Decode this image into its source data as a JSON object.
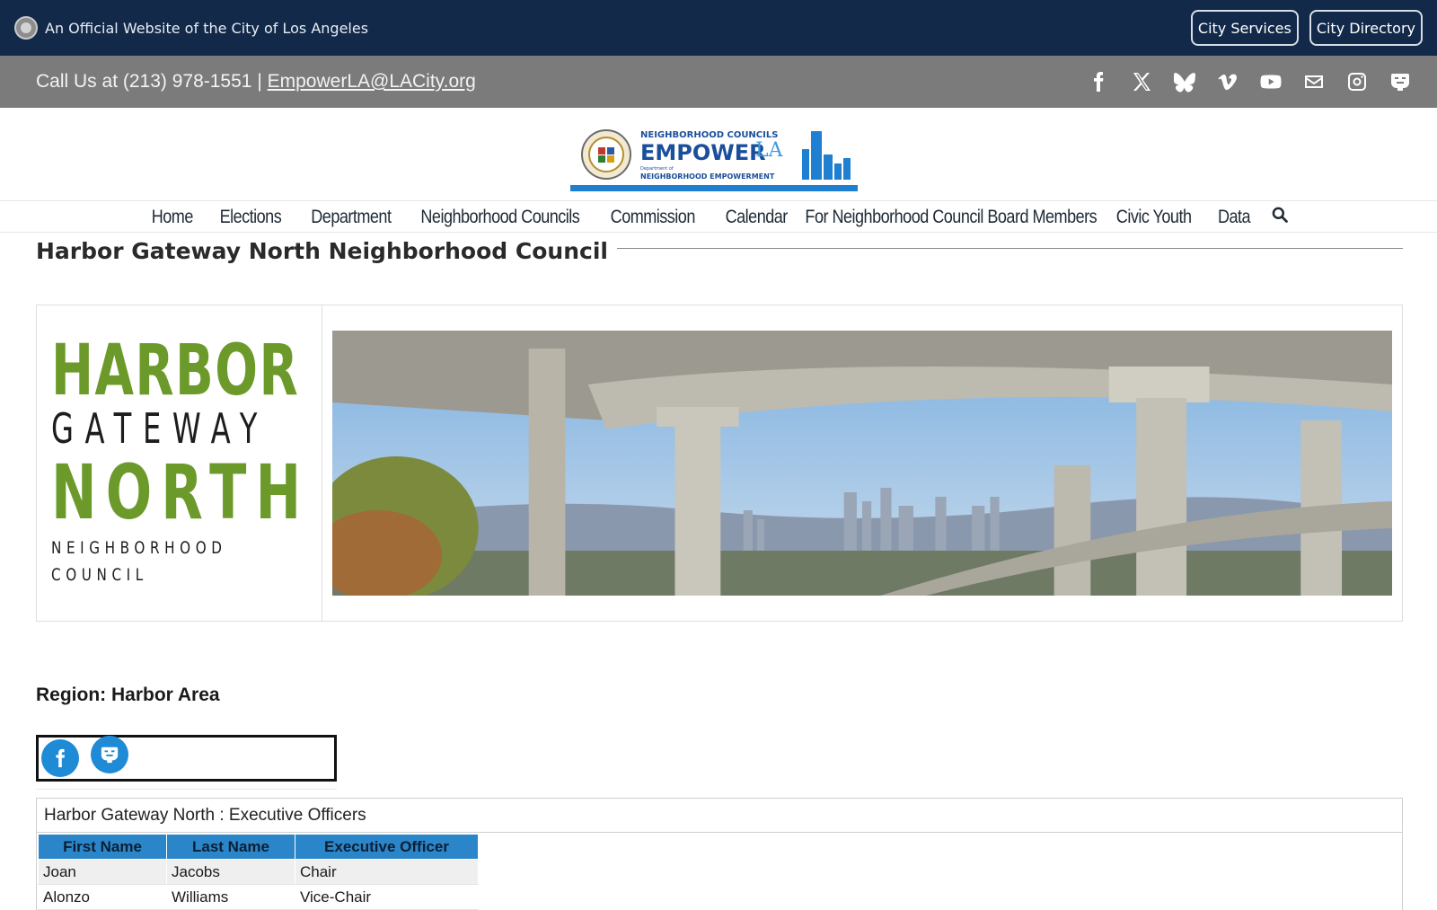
{
  "official_bar": {
    "text": "An Official Website of the City of Los Angeles",
    "buttons": [
      "City Services",
      "City Directory"
    ]
  },
  "contact": {
    "phone_text": "Call Us at (213) 978-1551",
    "separator": "|",
    "email": "EmpowerLA@LACity.org"
  },
  "social_top": [
    "facebook-icon",
    "x-icon",
    "bluesky-icon",
    "vimeo-icon",
    "youtube-icon",
    "mail-icon",
    "instagram-icon",
    "nextdoor-icon"
  ],
  "logo": {
    "line1": "NEIGHBORHOOD COUNCILS",
    "line2": "EMPOWER",
    "line2b": "LA",
    "line3": "Department of",
    "line4": "NEIGHBORHOOD EMPOWERMENT"
  },
  "nav": {
    "items": [
      "Home",
      "Elections",
      "Department",
      "Neighborhood Councils",
      "Commission",
      "Calendar",
      "For Neighborhood Council Board Members",
      "Civic Youth",
      "Data"
    ]
  },
  "page": {
    "title": "Harbor Gateway North Neighborhood Council"
  },
  "banner": {
    "logo_harbor": "HARBOR",
    "logo_gateway": "GATEWAY",
    "logo_north": "NORTH",
    "logo_nc": "NEIGHBORHOOD COUNCIL"
  },
  "region": "Region: Harbor Area",
  "officers": {
    "title": "Harbor Gateway North : Executive Officers",
    "columns": [
      "First Name",
      "Last Name",
      "Executive Officer"
    ],
    "rows": [
      [
        "Joan",
        "Jacobs",
        "Chair"
      ],
      [
        "Alonzo",
        "Williams",
        "Vice-Chair"
      ]
    ]
  },
  "colors": {
    "top_bar": "#12294a",
    "contact_bar": "#7b7b7b",
    "accent_blue": "#2b86c9",
    "hgn_green": "#6c9a2a"
  }
}
